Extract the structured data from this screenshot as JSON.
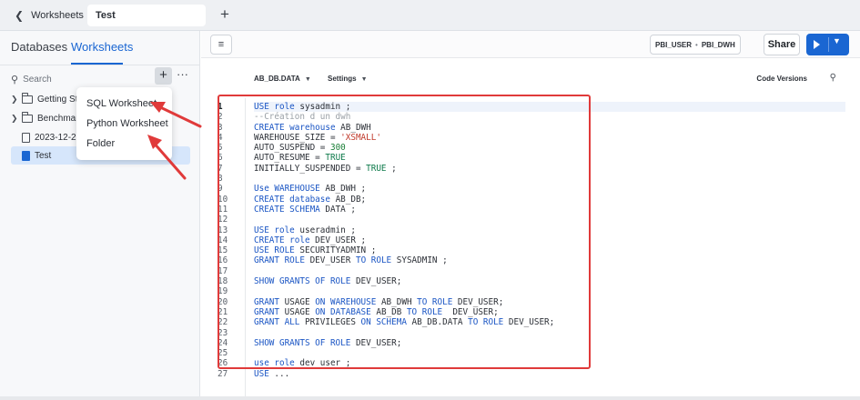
{
  "topbar": {
    "back_label": "Worksheets",
    "active_tab": "Test",
    "add_tab": "+"
  },
  "leftpanel": {
    "tabs": {
      "databases": "Databases",
      "worksheets": "Worksheets"
    },
    "search_label": "Search",
    "plus": "+",
    "more": "···",
    "items": [
      {
        "label": "Getting Sta"
      },
      {
        "label": "Benchmark"
      },
      {
        "label": "2023-12-27"
      },
      {
        "label": "Test"
      }
    ]
  },
  "menu": {
    "items": [
      "SQL Worksheet",
      "Python Worksheet",
      "Folder"
    ]
  },
  "header": {
    "role": "PBI_USER",
    "warehouse": "PBI_DWH",
    "share": "Share"
  },
  "subbar": {
    "database": "AB_DB.DATA",
    "settings": "Settings",
    "code_versions": "Code Versions"
  },
  "editor": {
    "line_numbers": [
      "1",
      "2",
      "3",
      "4",
      "5",
      "6",
      "7",
      "8",
      "9",
      "10",
      "11",
      "12",
      "13",
      "14",
      "15",
      "16",
      "17",
      "18",
      "19",
      "20",
      "21",
      "22",
      "23",
      "24",
      "25",
      "26",
      "27"
    ]
  },
  "colors": {
    "accent": "#1a66d2",
    "highlight_box": "#e03a3a",
    "arrow": "#e03a3a"
  }
}
